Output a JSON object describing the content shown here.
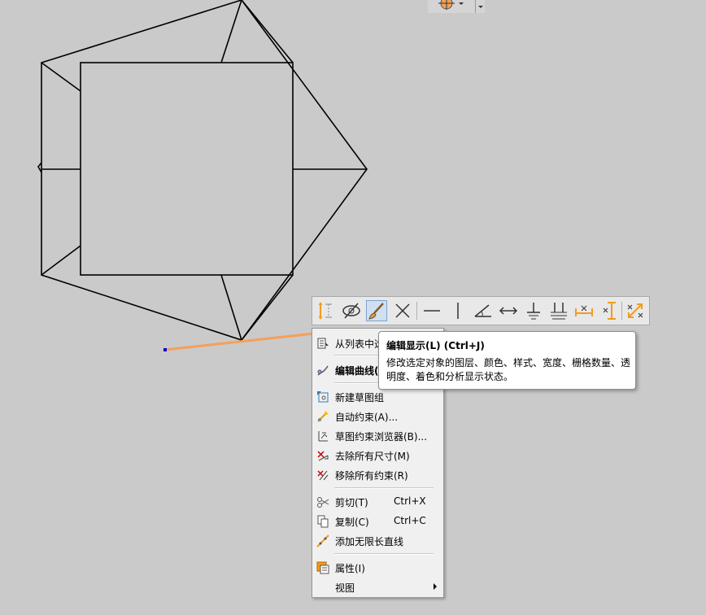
{
  "toolbar": {
    "items": [
      {
        "name": "dimension-icon"
      },
      {
        "name": "hide-icon"
      },
      {
        "name": "edit-display-brush-icon",
        "active": true
      },
      {
        "name": "delete-x-icon"
      },
      {
        "name": "horizontal-constraint-icon"
      },
      {
        "name": "vertical-constraint-icon"
      },
      {
        "name": "angle-icon"
      },
      {
        "name": "parallel-dimension-icon"
      },
      {
        "name": "perpendicular-icon"
      },
      {
        "name": "parallel-icon"
      },
      {
        "name": "horizontal-dimension-icon"
      },
      {
        "name": "vertical-dimension-icon"
      },
      {
        "name": "auto-dimension-icon"
      }
    ]
  },
  "tooltip": {
    "title": "编辑显示(L)  (Ctrl+J)",
    "description": "修改选定对象的图层、颜色、样式、宽度、栅格数量、透明度、着色和分析显示状态。"
  },
  "context_menu": {
    "items": [
      {
        "label": "从列表中选",
        "icon": "list-select-icon"
      },
      {
        "label": "编辑曲线(",
        "icon": "edit-curve-icon",
        "bold": true
      },
      {
        "label": "新建草图组",
        "icon": "new-sketch-group-icon"
      },
      {
        "label": "自动约束(A)...",
        "icon": "auto-constrain-icon"
      },
      {
        "label": "草图约束浏览器(B)...",
        "icon": "constraint-browser-icon"
      },
      {
        "label": "去除所有尺寸(M)",
        "icon": "remove-dimensions-icon"
      },
      {
        "label": "移除所有约束(R)",
        "icon": "remove-constraints-icon"
      },
      {
        "label": "剪切(T)",
        "shortcut": "Ctrl+X",
        "icon": "cut-icon"
      },
      {
        "label": "复制(C)",
        "shortcut": "Ctrl+C",
        "icon": "copy-icon"
      },
      {
        "label": "添加无限长直线",
        "icon": "infinite-line-icon"
      },
      {
        "label": "属性(I)",
        "icon": "properties-icon"
      },
      {
        "label": "视图",
        "icon": "",
        "submenu": true
      }
    ]
  },
  "colors": {
    "background": "#cacaca",
    "selected_curve": "#f4a05a",
    "sketch_lines": "#000000",
    "endpoint": "#0000cc"
  }
}
